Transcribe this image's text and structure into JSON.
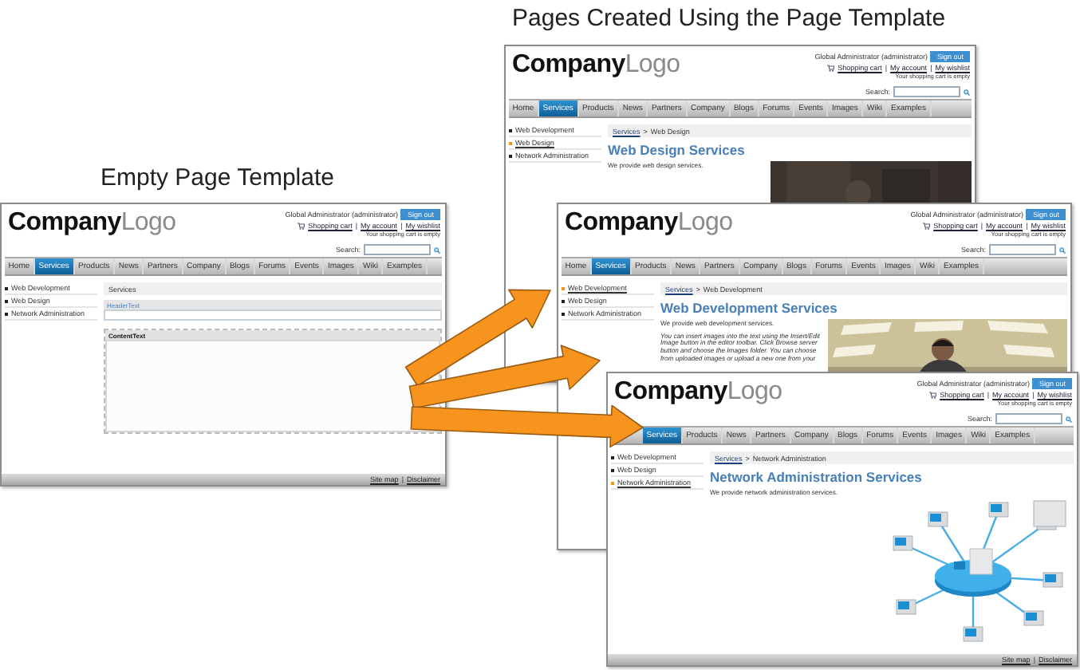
{
  "heading_created": "Pages Created Using the Page Template",
  "heading_empty": "Empty Page Template",
  "separator": "|",
  "breadcrumb_separator": ">",
  "pages": [
    {
      "kind": "template",
      "logo": "**Company**Logo",
      "user": "Global Administrator (administrator)",
      "sign_out": "Sign out",
      "links": [
        "Shopping cart",
        "My account",
        "My wishlist"
      ],
      "cart_note": "Your shopping cart is empty",
      "search_label": "Search:",
      "tabs": [
        {
          "label": "Home",
          "selected": false
        },
        {
          "label": "Services",
          "selected": true
        },
        {
          "label": "Products",
          "selected": false
        },
        {
          "label": "News",
          "selected": false
        },
        {
          "label": "Partners",
          "selected": false
        },
        {
          "label": "Company",
          "selected": false
        },
        {
          "label": "Blogs",
          "selected": false
        },
        {
          "label": "Forums",
          "selected": false
        },
        {
          "label": "Events",
          "selected": false
        },
        {
          "label": "Images",
          "selected": false
        },
        {
          "label": "Wiki",
          "selected": false
        },
        {
          "label": "Examples",
          "selected": false
        }
      ],
      "side_items": [
        {
          "label": "Web Development",
          "selected": false
        },
        {
          "label": "Web Design",
          "selected": false
        },
        {
          "label": "Network Administration",
          "selected": false
        }
      ],
      "breadcrumb": [
        {
          "text": "Services",
          "link": false
        }
      ],
      "header_label": "HeaderText",
      "content_label": "ContentText",
      "footer_links": [
        "Site map",
        "Disclaimer"
      ]
    },
    {
      "kind": "content",
      "logo": "**Company**Logo",
      "user": "Global Administrator (administrator)",
      "sign_out": "Sign out",
      "links": [
        "Shopping cart",
        "My account",
        "My wishlist"
      ],
      "cart_note": "Your shopping cart is empty",
      "search_label": "Search:",
      "tabs": [
        {
          "label": "Home",
          "selected": false
        },
        {
          "label": "Services",
          "selected": true
        },
        {
          "label": "Products",
          "selected": false
        },
        {
          "label": "News",
          "selected": false
        },
        {
          "label": "Partners",
          "selected": false
        },
        {
          "label": "Company",
          "selected": false
        },
        {
          "label": "Blogs",
          "selected": false
        },
        {
          "label": "Forums",
          "selected": false
        },
        {
          "label": "Events",
          "selected": false
        },
        {
          "label": "Images",
          "selected": false
        },
        {
          "label": "Wiki",
          "selected": false
        },
        {
          "label": "Examples",
          "selected": false
        }
      ],
      "side_items": [
        {
          "label": "Web Development",
          "selected": false
        },
        {
          "label": "Web Design",
          "selected": true
        },
        {
          "label": "Network Administration",
          "selected": false
        }
      ],
      "breadcrumb": [
        {
          "text": "Services",
          "link": true
        },
        {
          "text": "Web Design",
          "link": false
        }
      ],
      "title": "Web Design Services",
      "paragraphs": [
        {
          "text": "We provide web design services.",
          "italic": false
        }
      ],
      "image": {
        "kind": "picture"
      }
    },
    {
      "kind": "content",
      "logo": "**Company**Logo",
      "user": "Global Administrator (administrator)",
      "sign_out": "Sign out",
      "links": [
        "Shopping cart",
        "My account",
        "My wishlist"
      ],
      "cart_note": "Your shopping cart is empty",
      "search_label": "Search:",
      "tabs": [
        {
          "label": "Home",
          "selected": false
        },
        {
          "label": "Services",
          "selected": true
        },
        {
          "label": "Products",
          "selected": false
        },
        {
          "label": "News",
          "selected": false
        },
        {
          "label": "Partners",
          "selected": false
        },
        {
          "label": "Company",
          "selected": false
        },
        {
          "label": "Blogs",
          "selected": false
        },
        {
          "label": "Forums",
          "selected": false
        },
        {
          "label": "Events",
          "selected": false
        },
        {
          "label": "Images",
          "selected": false
        },
        {
          "label": "Wiki",
          "selected": false
        },
        {
          "label": "Examples",
          "selected": false
        }
      ],
      "side_items": [
        {
          "label": "Web Development",
          "selected": true
        },
        {
          "label": "Web Design",
          "selected": false
        },
        {
          "label": "Network Administration",
          "selected": false
        }
      ],
      "breadcrumb": [
        {
          "text": "Services",
          "link": true
        },
        {
          "text": "Web Development",
          "link": false
        }
      ],
      "title": "Web Development Services",
      "paragraphs": [
        {
          "text": "We provide web development services.",
          "italic": false
        },
        {
          "text": "You can insert images into the text using the Insert/Edit Image button in the editor toolbar. Click Browse server button and choose the Images folder. You can choose from uploaded images or upload a new one from your",
          "italic": true
        }
      ],
      "image": {
        "kind": "picture"
      }
    },
    {
      "kind": "content",
      "logo": "**Company**Logo",
      "user": "Global Administrator (administrator)",
      "sign_out": "Sign out",
      "links": [
        "Shopping cart",
        "My account",
        "My wishlist"
      ],
      "cart_note": "Your shopping cart is empty",
      "search_label": "Search:",
      "tabs": [
        {
          "label": "Services",
          "selected": true
        },
        {
          "label": "Products",
          "selected": false
        },
        {
          "label": "News",
          "selected": false
        },
        {
          "label": "Partners",
          "selected": false
        },
        {
          "label": "Company",
          "selected": false
        },
        {
          "label": "Blogs",
          "selected": false
        },
        {
          "label": "Forums",
          "selected": false
        },
        {
          "label": "Events",
          "selected": false
        },
        {
          "label": "Images",
          "selected": false
        },
        {
          "label": "Wiki",
          "selected": false
        },
        {
          "label": "Examples",
          "selected": false
        }
      ],
      "side_items": [
        {
          "label": "Web Development",
          "selected": false
        },
        {
          "label": "Web Design",
          "selected": false
        },
        {
          "label": "Network Administration",
          "selected": true
        }
      ],
      "breadcrumb": [
        {
          "text": "Services",
          "link": true
        },
        {
          "text": "Network Administration",
          "link": false
        }
      ],
      "title": "Network Administration Services",
      "paragraphs": [
        {
          "text": "We provide network administration services.",
          "italic": false
        }
      ],
      "image": {
        "kind": "illustration"
      },
      "footer_links": [
        "Site map",
        "Disclaimer"
      ]
    }
  ]
}
